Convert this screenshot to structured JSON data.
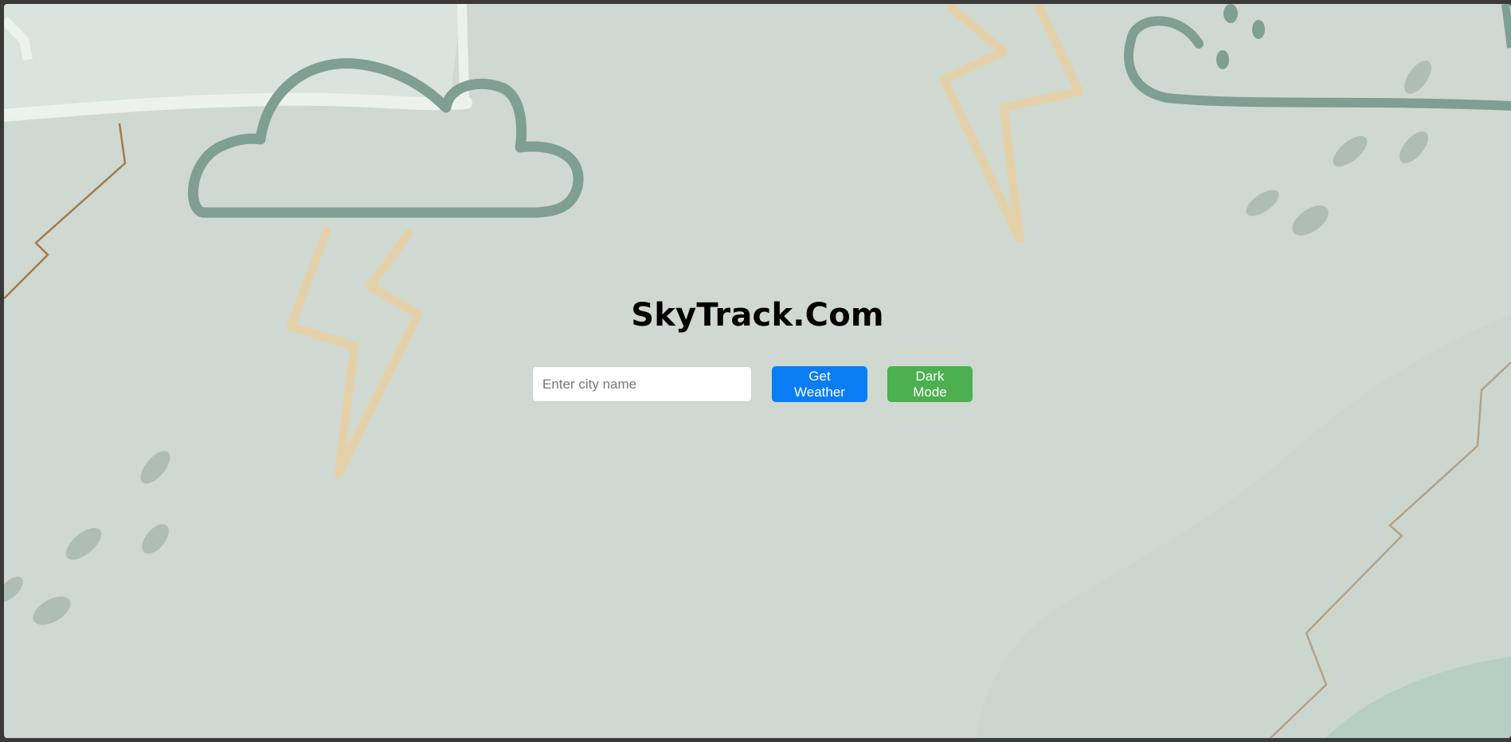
{
  "app": {
    "title": "SkyTrack.Com"
  },
  "search": {
    "placeholder": "Enter city name",
    "value": ""
  },
  "buttons": {
    "get_weather_label": "Get Weather",
    "dark_mode_label": "Dark Mode"
  },
  "theme": {
    "background_color": "#cfd9d1",
    "cloud_color": "#7f9e94",
    "lightning_color": "#e7cfa4",
    "crack_color": "#9a6a3a",
    "get_weather_color": "#0a7df5",
    "dark_mode_color": "#4caf50"
  },
  "decorations": [
    "cloud-icon",
    "lightning-icon",
    "raindrop-icon"
  ]
}
